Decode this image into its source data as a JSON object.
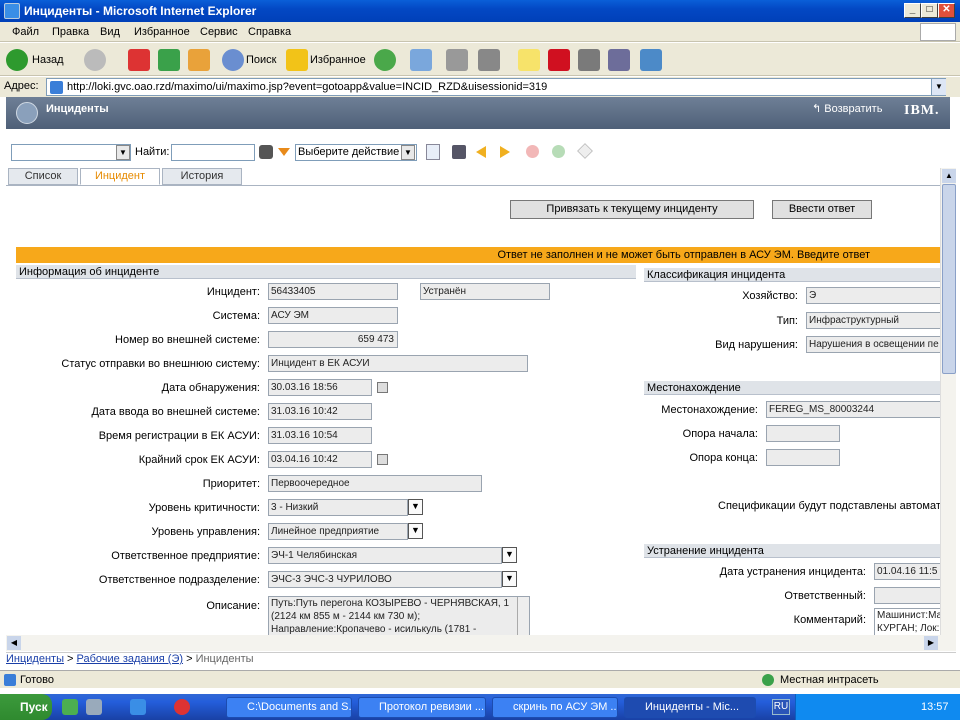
{
  "window": {
    "title": "Инциденты - Microsoft Internet Explorer",
    "min": "_",
    "max": "□",
    "close": "✕"
  },
  "menu": [
    "Файл",
    "Правка",
    "Вид",
    "Избранное",
    "Сервис",
    "Справка"
  ],
  "toolbar": {
    "back": "Назад",
    "search": "Поиск",
    "favorites": "Избранное"
  },
  "address": {
    "label": "Адрес:",
    "url": "http://loki.gvc.oao.rzd/maximo/ui/maximo.jsp?event=gotoapp&value=INCID_RZD&uisessionid=319"
  },
  "app": {
    "title": "Инциденты",
    "return": "Возвратить",
    "brand": "IBM."
  },
  "mxbar": {
    "find_label": "Найти:",
    "action_select": "Выберите действие"
  },
  "tabs": [
    "Список",
    "Инцидент",
    "История"
  ],
  "buttons": {
    "link": "Привязать к текущему инциденту",
    "reply": "Ввести ответ"
  },
  "warning": "Ответ не заполнен и не может быть отправлен в АСУ ЭМ. Введите ответ",
  "left": {
    "header": "Информация об инциденте",
    "fields": [
      {
        "label": "Инцидент:",
        "value": "56433405"
      },
      {
        "label": "Система:",
        "value": "АСУ ЭМ"
      },
      {
        "label": "Номер во внешней системе:",
        "value": "659 473"
      },
      {
        "label": "Статус отправки во внешнюю систему:",
        "value": "Инцидент в ЕК АСУИ"
      },
      {
        "label": "Дата обнаружения:",
        "value": "30.03.16 18:56"
      },
      {
        "label": "Дата ввода во внешней системе:",
        "value": "31.03.16 10:42"
      },
      {
        "label": "Время регистрации в ЕК АСУИ:",
        "value": "31.03.16 10:54"
      },
      {
        "label": "Крайний срок ЕК АСУИ:",
        "value": "03.04.16 10:42"
      },
      {
        "label": "Приоритет:",
        "value": "Первоочередное"
      },
      {
        "label": "Уровень критичности:",
        "value": "3 - Низкий"
      },
      {
        "label": "Уровень управления:",
        "value": "Линейное предприятие"
      },
      {
        "label": "Ответственное предприятие:",
        "value": "ЭЧ-1 Челябинская"
      },
      {
        "label": "Ответственное подразделение:",
        "value": "ЭЧС-3 ЭЧС-3 ЧУРИЛОВО"
      },
      {
        "label": "Описание:",
        "value": "Путь:Путь перегона КОЗЫРЕВО - ЧЕРНЯВСКАЯ, 1 (2124 км 855 м - 2144 км 730 м); Направление:Кропачево - исилькуль (1781 -"
      }
    ],
    "status_value": "Устранён"
  },
  "right": {
    "classif_header": "Классификация инцидента",
    "classif": [
      {
        "label": "Хозяйство:",
        "value": "Э"
      },
      {
        "label": "Тип:",
        "value": "Инфраструктурный"
      },
      {
        "label": "Вид нарушения:",
        "value": "Нарушения в освещении пе"
      }
    ],
    "loc_header": "Местонахождение",
    "loc": [
      {
        "label": "Местонахождение:",
        "value": "FEREG_MS_80003244"
      },
      {
        "label": "Опора начала:",
        "value": ""
      },
      {
        "label": "Опора конца:",
        "value": ""
      }
    ],
    "loc_note": "Спецификации будут подставлены автомати",
    "fix_header": "Устранение инцидента",
    "fix": [
      {
        "label": "Дата устранения инцидента:",
        "value": "01.04.16 11:5"
      },
      {
        "label": "Ответственный:",
        "value": ""
      },
      {
        "label": "Комментарий:",
        "value": "Машинист:Ма КУРГАН; Лок:"
      }
    ]
  },
  "breadcrumb": {
    "a": "Инциденты",
    "b": "Рабочие задания (Э)",
    "c": "Инциденты"
  },
  "status": {
    "left": "Готово",
    "zone": "Местная интрасеть"
  },
  "taskbar": {
    "start": "Пуск",
    "tasks": [
      "C:\\Documents and S...",
      "Протокол ревизии ...",
      "скринь по АСУ ЭМ ...",
      "Инциденты - Mic..."
    ],
    "lang": "RU",
    "clock": "13:57"
  }
}
